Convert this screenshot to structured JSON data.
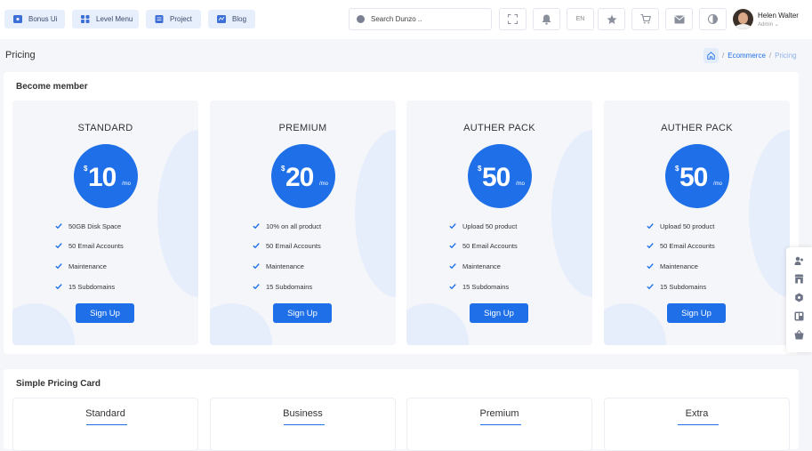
{
  "topnav": {
    "items": [
      {
        "label": "Bonus Ui",
        "icon": "bonus-ui-icon"
      },
      {
        "label": "Level Menu",
        "icon": "level-menu-icon"
      },
      {
        "label": "Project",
        "icon": "project-icon"
      },
      {
        "label": "Blog",
        "icon": "blog-icon"
      }
    ]
  },
  "search": {
    "placeholder": "Search Dunzo .."
  },
  "toolbar": {
    "language": "EN"
  },
  "user": {
    "name": "Helen Walter",
    "role": "Admin"
  },
  "page": {
    "title": "Pricing"
  },
  "breadcrumb": {
    "items": [
      "Ecommerce",
      "Pricing"
    ],
    "separator": "/"
  },
  "become_member": {
    "title": "Become member",
    "cards": [
      {
        "title": "STANDARD",
        "currency": "$",
        "amount": "10",
        "period": "/mo",
        "features": [
          "50GB Disk Space",
          "50 Email Accounts",
          "Maintenance",
          "15 Subdomains"
        ],
        "button": "Sign Up"
      },
      {
        "title": "PREMIUM",
        "currency": "$",
        "amount": "20",
        "period": "/mo",
        "features": [
          "10% on all product",
          "50 Email Accounts",
          "Maintenance",
          "15 Subdomains"
        ],
        "button": "Sign Up"
      },
      {
        "title": "AUTHER PACK",
        "currency": "$",
        "amount": "50",
        "period": "/mo",
        "features": [
          "Upload 50 product",
          "50 Email Accounts",
          "Maintenance",
          "15 Subdomains"
        ],
        "button": "Sign Up"
      },
      {
        "title": "AUTHER PACK",
        "currency": "$",
        "amount": "50",
        "period": "/mo",
        "features": [
          "Upload 50 product",
          "50 Email Accounts",
          "Maintenance",
          "15 Subdomains"
        ],
        "button": "Sign Up"
      }
    ]
  },
  "simple_pricing": {
    "title": "Simple Pricing Card",
    "cards": [
      "Standard",
      "Business",
      "Premium",
      "Extra"
    ]
  },
  "colors": {
    "primary": "#1f70e8",
    "light_accent": "#e6edfb",
    "nav_button_bg": "#e8effc"
  }
}
